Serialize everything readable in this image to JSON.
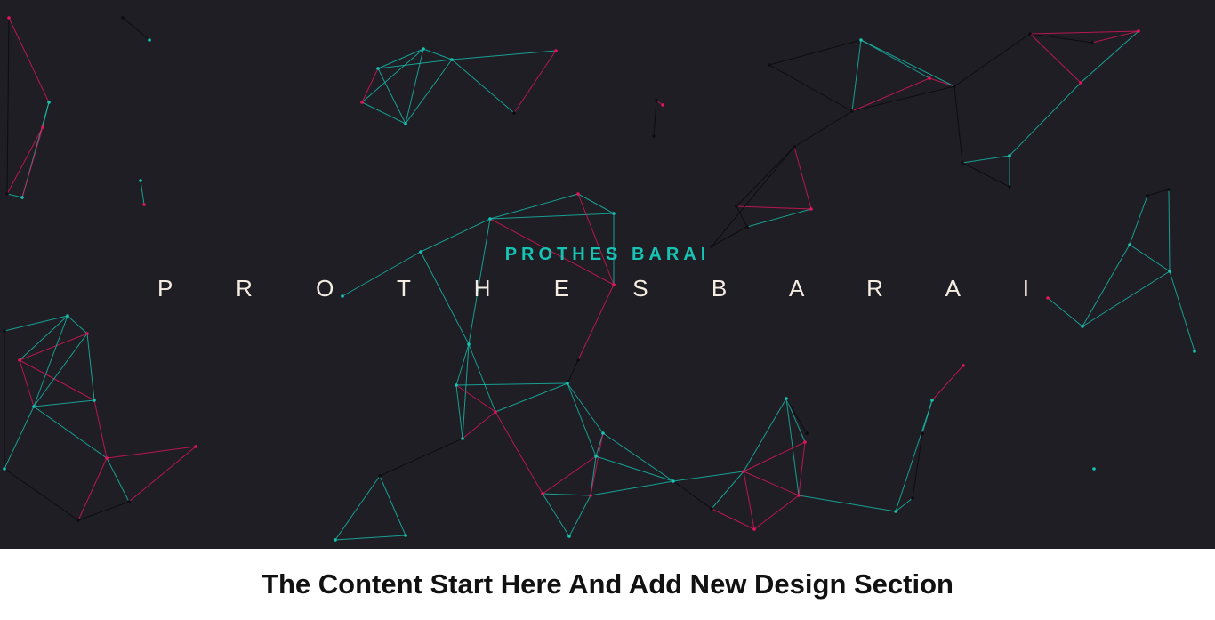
{
  "hero": {
    "subtitle": "PROTHES BARAI",
    "title": "P R O T H E S  B A R A I"
  },
  "content": {
    "heading": "The Content Start Here And Add New Design Section"
  },
  "colors": {
    "background": "#1e1e24",
    "teal": "#17c3b2",
    "pink": "#e3165b",
    "node_dark": "#0d0d10",
    "title": "#f5ede2"
  }
}
